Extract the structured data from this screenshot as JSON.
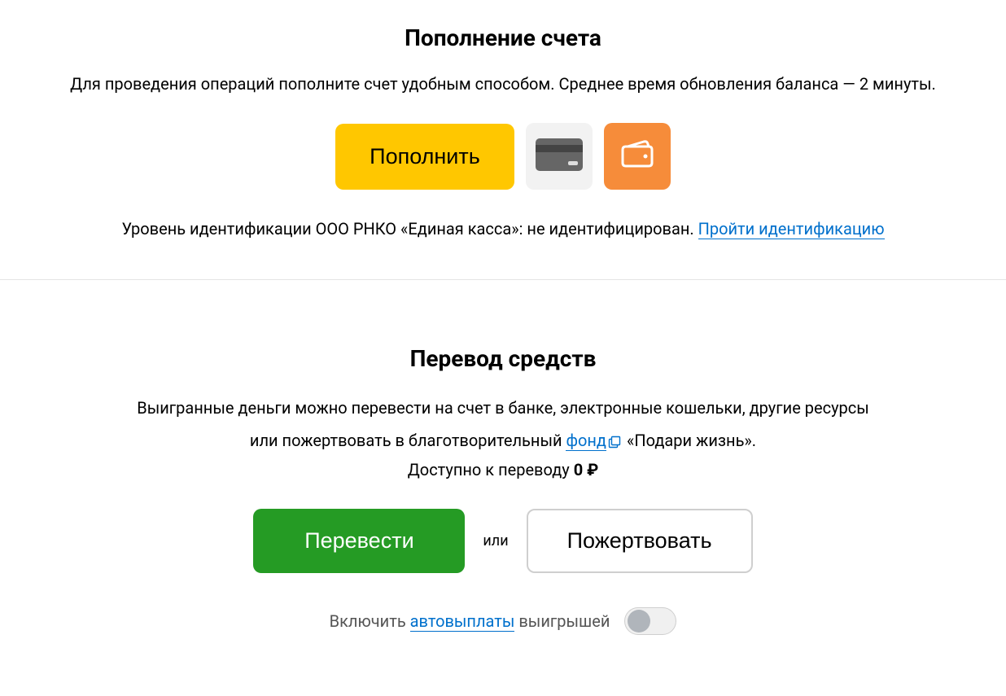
{
  "topup": {
    "title": "Пополнение счета",
    "subtitle": "Для проведения операций пополните счет удобным способом. Среднее время обновления баланса — 2 минуты.",
    "button_label": "Пополнить",
    "ident_prefix": "Уровень идентификации ООО РНКО «Единая касса»: не идентифицирован. ",
    "ident_link": "Пройти идентификацию"
  },
  "transfer": {
    "title": "Перевод средств",
    "line1": "Выигранные деньги можно перевести на счет в банке, электронные кошельки, другие ресурсы",
    "line2_prefix": "или пожертвовать в благотворительный ",
    "fund_link": "фонд",
    "line2_suffix": " «Подари жизнь».",
    "available_label": "Доступно к переводу ",
    "available_value": "0 ₽",
    "transfer_button": "Перевести",
    "or_label": "или",
    "donate_button": "Пожертвовать",
    "autopay_prefix": "Включить ",
    "autopay_link": "автовыплаты",
    "autopay_suffix": " выигрышей"
  }
}
